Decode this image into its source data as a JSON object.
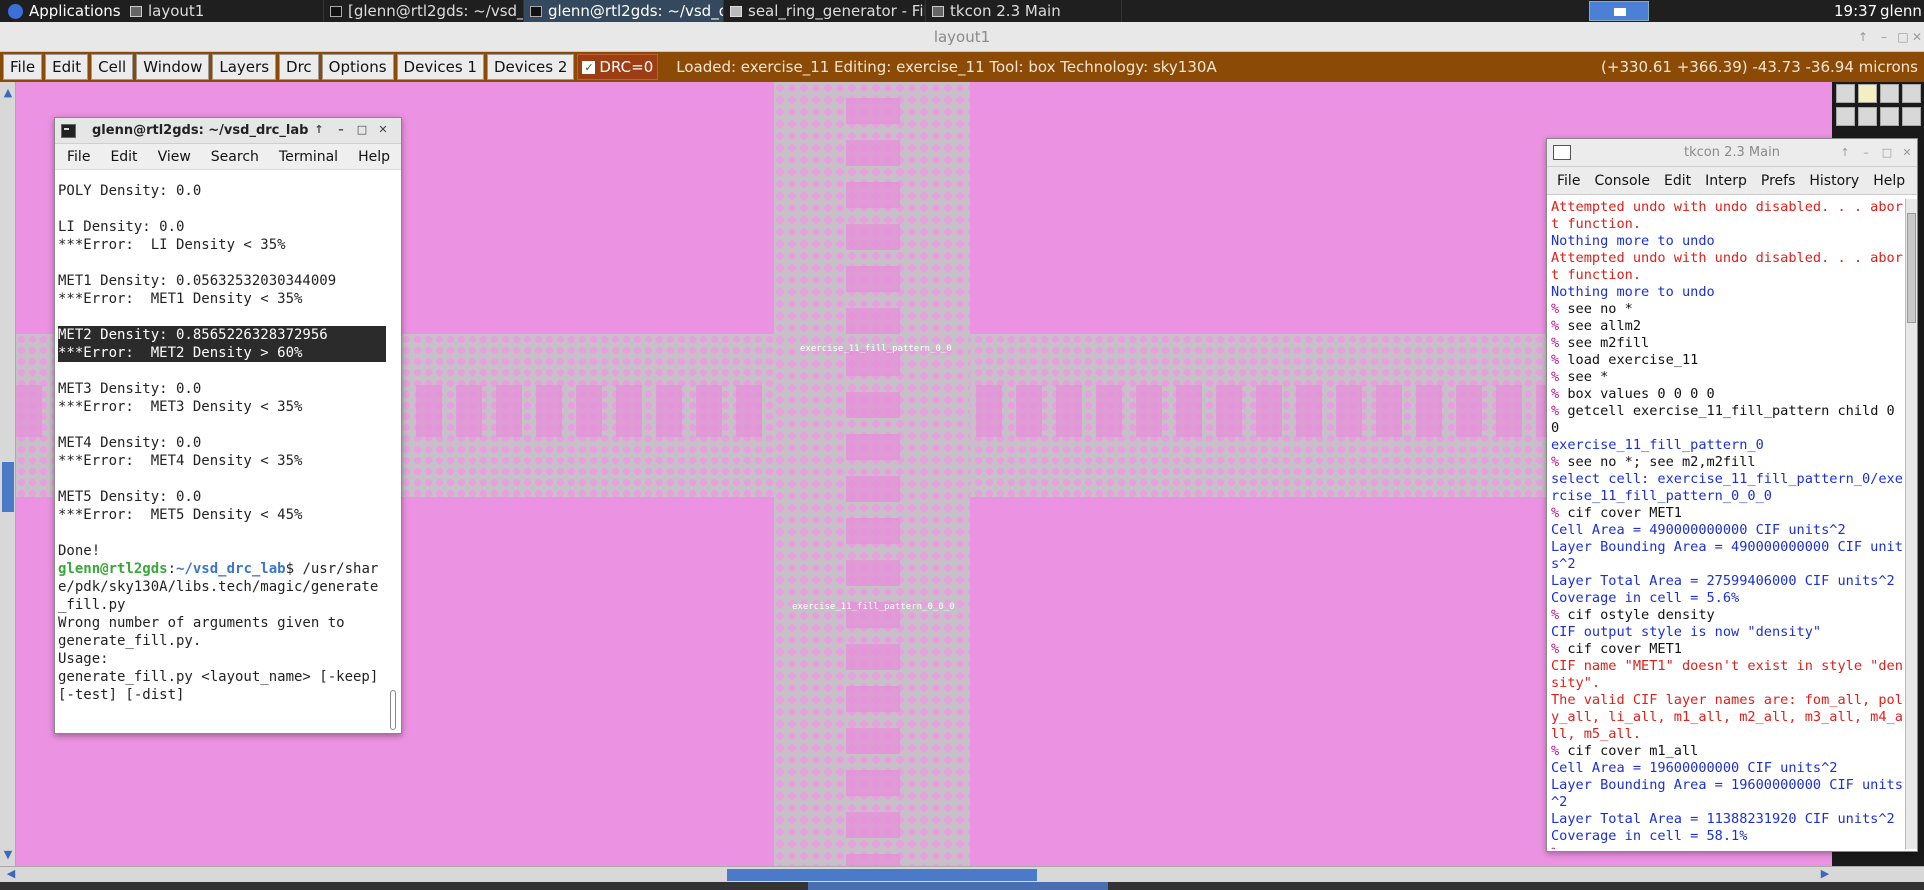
{
  "taskbar": {
    "apps_label": "Applications",
    "tasks": [
      {
        "label": "layout1"
      },
      {
        "label": "[glenn@rtl2gds: ~/vsd_..."
      },
      {
        "label": "glenn@rtl2gds: ~/vsd_d..."
      },
      {
        "label": "seal_ring_generator - Fil..."
      },
      {
        "label": "tkcon 2.3 Main"
      }
    ],
    "clock": "19:37",
    "user": "glenn"
  },
  "magic": {
    "window_title": "layout1",
    "menu": [
      "File",
      "Edit",
      "Cell",
      "Window",
      "Layers",
      "Drc",
      "Options",
      "Devices 1",
      "Devices 2"
    ],
    "drc_label": "DRC=0",
    "status": "Loaded: exercise_11 Editing: exercise_11 Tool: box  Technology: sky130A",
    "coords": "(+330.61 +366.39) -43.73 -36.94 microns",
    "cell_labels": [
      "exercise_11_fill_pattern_0_0",
      "exercise_11_fill_pattern_0_0_0"
    ],
    "colors": {
      "background": "#ec92e2",
      "menubar": "#8b4a05",
      "fill": "#c8c0c8"
    }
  },
  "terminal": {
    "title": "glenn@rtl2gds: ~/vsd_drc_lab",
    "menu": [
      "File",
      "Edit",
      "View",
      "Search",
      "Terminal",
      "Help"
    ],
    "lines": {
      "poly": "POLY Density: 0.0",
      "li": "LI Density: 0.0",
      "li_err": "***Error:  LI Density < 35%",
      "met1": "MET1 Density: 0.05632532030344009",
      "met1_err": "***Error:  MET1 Density < 35%",
      "met2": "MET2 Density: 0.8565226328372956",
      "met2_err": "***Error:  MET2 Density > 60%",
      "met3": "MET3 Density: 0.0",
      "met3_err": "***Error:  MET3 Density < 35%",
      "met4": "MET4 Density: 0.0",
      "met4_err": "***Error:  MET4 Density < 35%",
      "met5": "MET5 Density: 0.0",
      "met5_err": "***Error:  MET5 Density < 45%",
      "done": "Done!",
      "prompt_user": "glenn@rtl2gds",
      "prompt_path": "~/vsd_drc_lab",
      "command": "$ /usr/share/pdk/sky130A/libs.tech/magic/generate_fill.py",
      "wrong": "Wrong number of arguments given to generate_fill.py.",
      "usage": "Usage:",
      "usage_line": "generate_fill.py <layout_name> [-keep] [-test] [-dist]"
    }
  },
  "tkcon": {
    "title": "tkcon 2.3 Main",
    "menu": [
      "File",
      "Console",
      "Edit",
      "Interp",
      "Prefs",
      "History",
      "Help"
    ],
    "lines": [
      {
        "t": "err",
        "text": "Attempted undo with undo disabled. . . abort function."
      },
      {
        "t": "out",
        "text": "Nothing more to undo"
      },
      {
        "t": "err",
        "text": "Attempted undo with undo disabled. . . abort function."
      },
      {
        "t": "out",
        "text": "Nothing more to undo"
      },
      {
        "t": "cmd",
        "text": "see no *"
      },
      {
        "t": "cmd",
        "text": "see allm2"
      },
      {
        "t": "cmd",
        "text": "see m2fill"
      },
      {
        "t": "cmd",
        "text": "load exercise_11"
      },
      {
        "t": "cmd",
        "text": "see *"
      },
      {
        "t": "cmd",
        "text": "box values 0 0 0 0"
      },
      {
        "t": "cmd",
        "text": "getcell exercise_11_fill_pattern child 0 0"
      },
      {
        "t": "out",
        "text": "exercise_11_fill_pattern_0"
      },
      {
        "t": "cmd",
        "text": "see no *; see m2,m2fill"
      },
      {
        "t": "out",
        "text": "select cell: exercise_11_fill_pattern_0/exercise_11_fill_pattern_0_0_0"
      },
      {
        "t": "cmd",
        "text": "cif cover MET1"
      },
      {
        "t": "out",
        "text": "Cell Area = 490000000000 CIF units^2"
      },
      {
        "t": "out",
        "text": "Layer Bounding Area = 490000000000 CIF units^2"
      },
      {
        "t": "out",
        "text": "Layer Total Area = 27599406000 CIF units^2"
      },
      {
        "t": "out",
        "text": "Coverage in cell = 5.6%"
      },
      {
        "t": "cmd",
        "text": "cif ostyle density"
      },
      {
        "t": "out",
        "text": "CIF output style is now \"density\""
      },
      {
        "t": "cmd",
        "text": "cif cover MET1"
      },
      {
        "t": "err",
        "text": "CIF name \"MET1\" doesn't exist in style \"density\"."
      },
      {
        "t": "err",
        "text": "The valid CIF layer names are: fom_all, poly_all, li_all, m1_all, m2_all, m3_all, m4_all, m5_all."
      },
      {
        "t": "cmd",
        "text": "cif cover m1_all"
      },
      {
        "t": "out",
        "text": "Cell Area = 19600000000 CIF units^2"
      },
      {
        "t": "out",
        "text": "Layer Bounding Area = 19600000000 CIF units^2"
      },
      {
        "t": "out",
        "text": "Layer Total Area = 11388231920 CIF units^2"
      },
      {
        "t": "out",
        "text": "Coverage in cell = 58.1%"
      },
      {
        "t": "prompt",
        "text": ""
      }
    ],
    "prompt_char": "%"
  }
}
